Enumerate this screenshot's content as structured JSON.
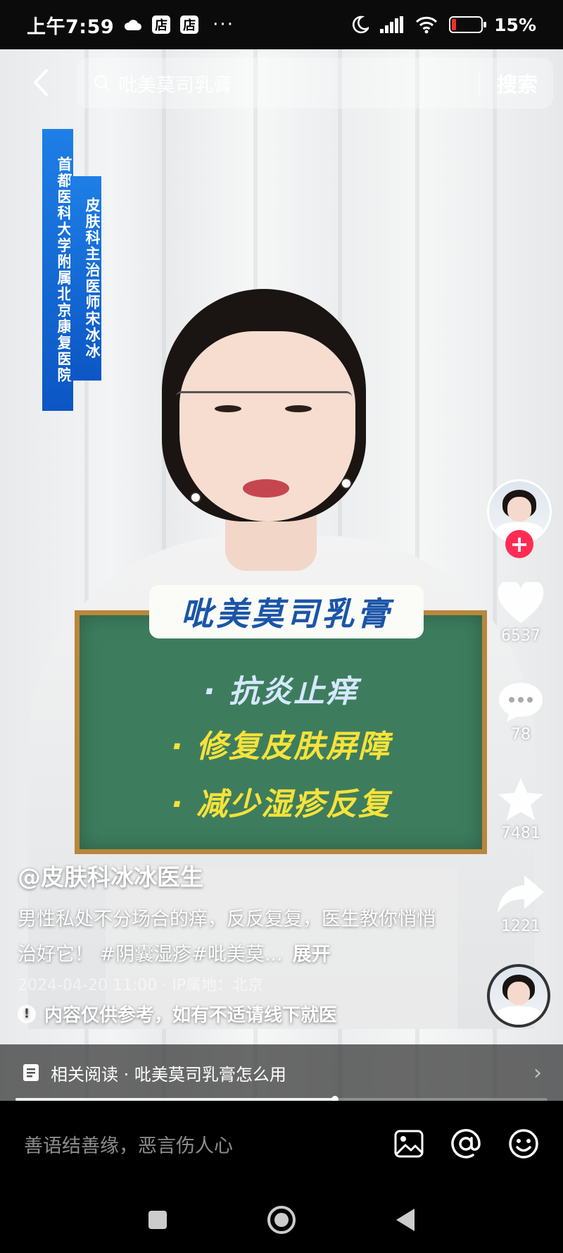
{
  "status_bar": {
    "time": "上午7:59",
    "shop_icon_1": "店",
    "shop_icon_2": "店",
    "more": "···",
    "battery_percent": 15,
    "battery_label": "15%"
  },
  "search": {
    "query": "吡美莫司乳膏",
    "button_label": "搜索"
  },
  "video": {
    "banner_line_1": "首都医科大学附属北京康复医院",
    "banner_line_2": "皮肤科主治医师宋冰冰",
    "board_title": "吡美莫司乳膏",
    "board_points": [
      "· 抗炎止痒",
      "· 修复皮肤屏障",
      "· 减少湿疹反复"
    ]
  },
  "side_actions": {
    "like_count": "6537",
    "comment_count": "78",
    "favorite_count": "7481",
    "share_count": "1221"
  },
  "caption": {
    "author": "@皮肤科冰冰医生",
    "description": "男性私处不分场合的痒，反反复复，医生教你悄悄治好它！ #阴囊湿疹#吡美莫...",
    "expand_label": "展开",
    "date": "2024-04-20 11:00 · IP属地：北京",
    "notice": "内容仅供参考，如有不适请线下就医"
  },
  "related": {
    "label": "相关阅读 · 吡美莫司乳膏怎么用"
  },
  "playback": {
    "progress": 0.6
  },
  "comment": {
    "placeholder": "善语结善缘，恶言伤人心"
  }
}
